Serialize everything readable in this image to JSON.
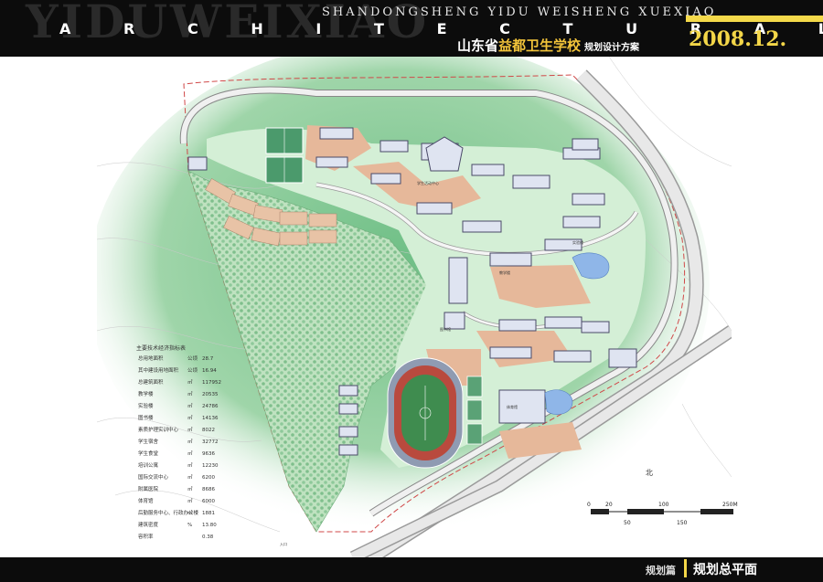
{
  "header": {
    "bg_title": "YIDUWEIXIAO",
    "subtitle_en": "SHANDONGSHENG YIDU WEISHENG XUEXIAO",
    "architectural_letters": [
      "A",
      "R",
      "C",
      "H",
      "I",
      "T",
      "E",
      "C",
      "T",
      "U",
      "R",
      "A",
      "L"
    ],
    "title_cn_prefix": "山东省",
    "title_cn_highlight": "益都卫生学校",
    "title_cn_suffix": "规划设计方案",
    "date": "2008.12."
  },
  "legend": {
    "title": "主要技术经济指标表",
    "rows": [
      {
        "label": "总用地面积",
        "unit": "公顷",
        "value": "28.7"
      },
      {
        "label": "其中建设用地面积",
        "unit": "公顷",
        "value": "16.94"
      },
      {
        "label": "总建筑面积",
        "unit": "㎡",
        "value": "117952"
      },
      {
        "label": "教学楼",
        "unit": "㎡",
        "value": "20535"
      },
      {
        "label": "实验楼",
        "unit": "㎡",
        "value": "24786"
      },
      {
        "label": "图书楼",
        "unit": "㎡",
        "value": "14136"
      },
      {
        "label": "素质护理实训中心",
        "unit": "㎡",
        "value": "8022"
      },
      {
        "label": "学生宿舍",
        "unit": "㎡",
        "value": "32772"
      },
      {
        "label": "学生食堂",
        "unit": "㎡",
        "value": "9636"
      },
      {
        "label": "培训公寓",
        "unit": "㎡",
        "value": "12230"
      },
      {
        "label": "国际交流中心",
        "unit": "㎡",
        "value": "6200"
      },
      {
        "label": "附属医院",
        "unit": "㎡",
        "value": "8686"
      },
      {
        "label": "体育馆",
        "unit": "㎡",
        "value": "6000"
      },
      {
        "label": "后勤服务中心、行政办公楼",
        "unit": "㎡",
        "value": "1881"
      },
      {
        "label": "建筑密度",
        "unit": "%",
        "value": "13.80"
      },
      {
        "label": "容积率",
        "unit": "",
        "value": "0.38"
      }
    ]
  },
  "scale": {
    "ticks_top": [
      "0",
      "20",
      "100",
      "250M"
    ],
    "ticks_bottom": [
      "50",
      "150"
    ]
  },
  "north_label": "北",
  "footer": {
    "section": "规划篇",
    "title": "规划总平面"
  }
}
